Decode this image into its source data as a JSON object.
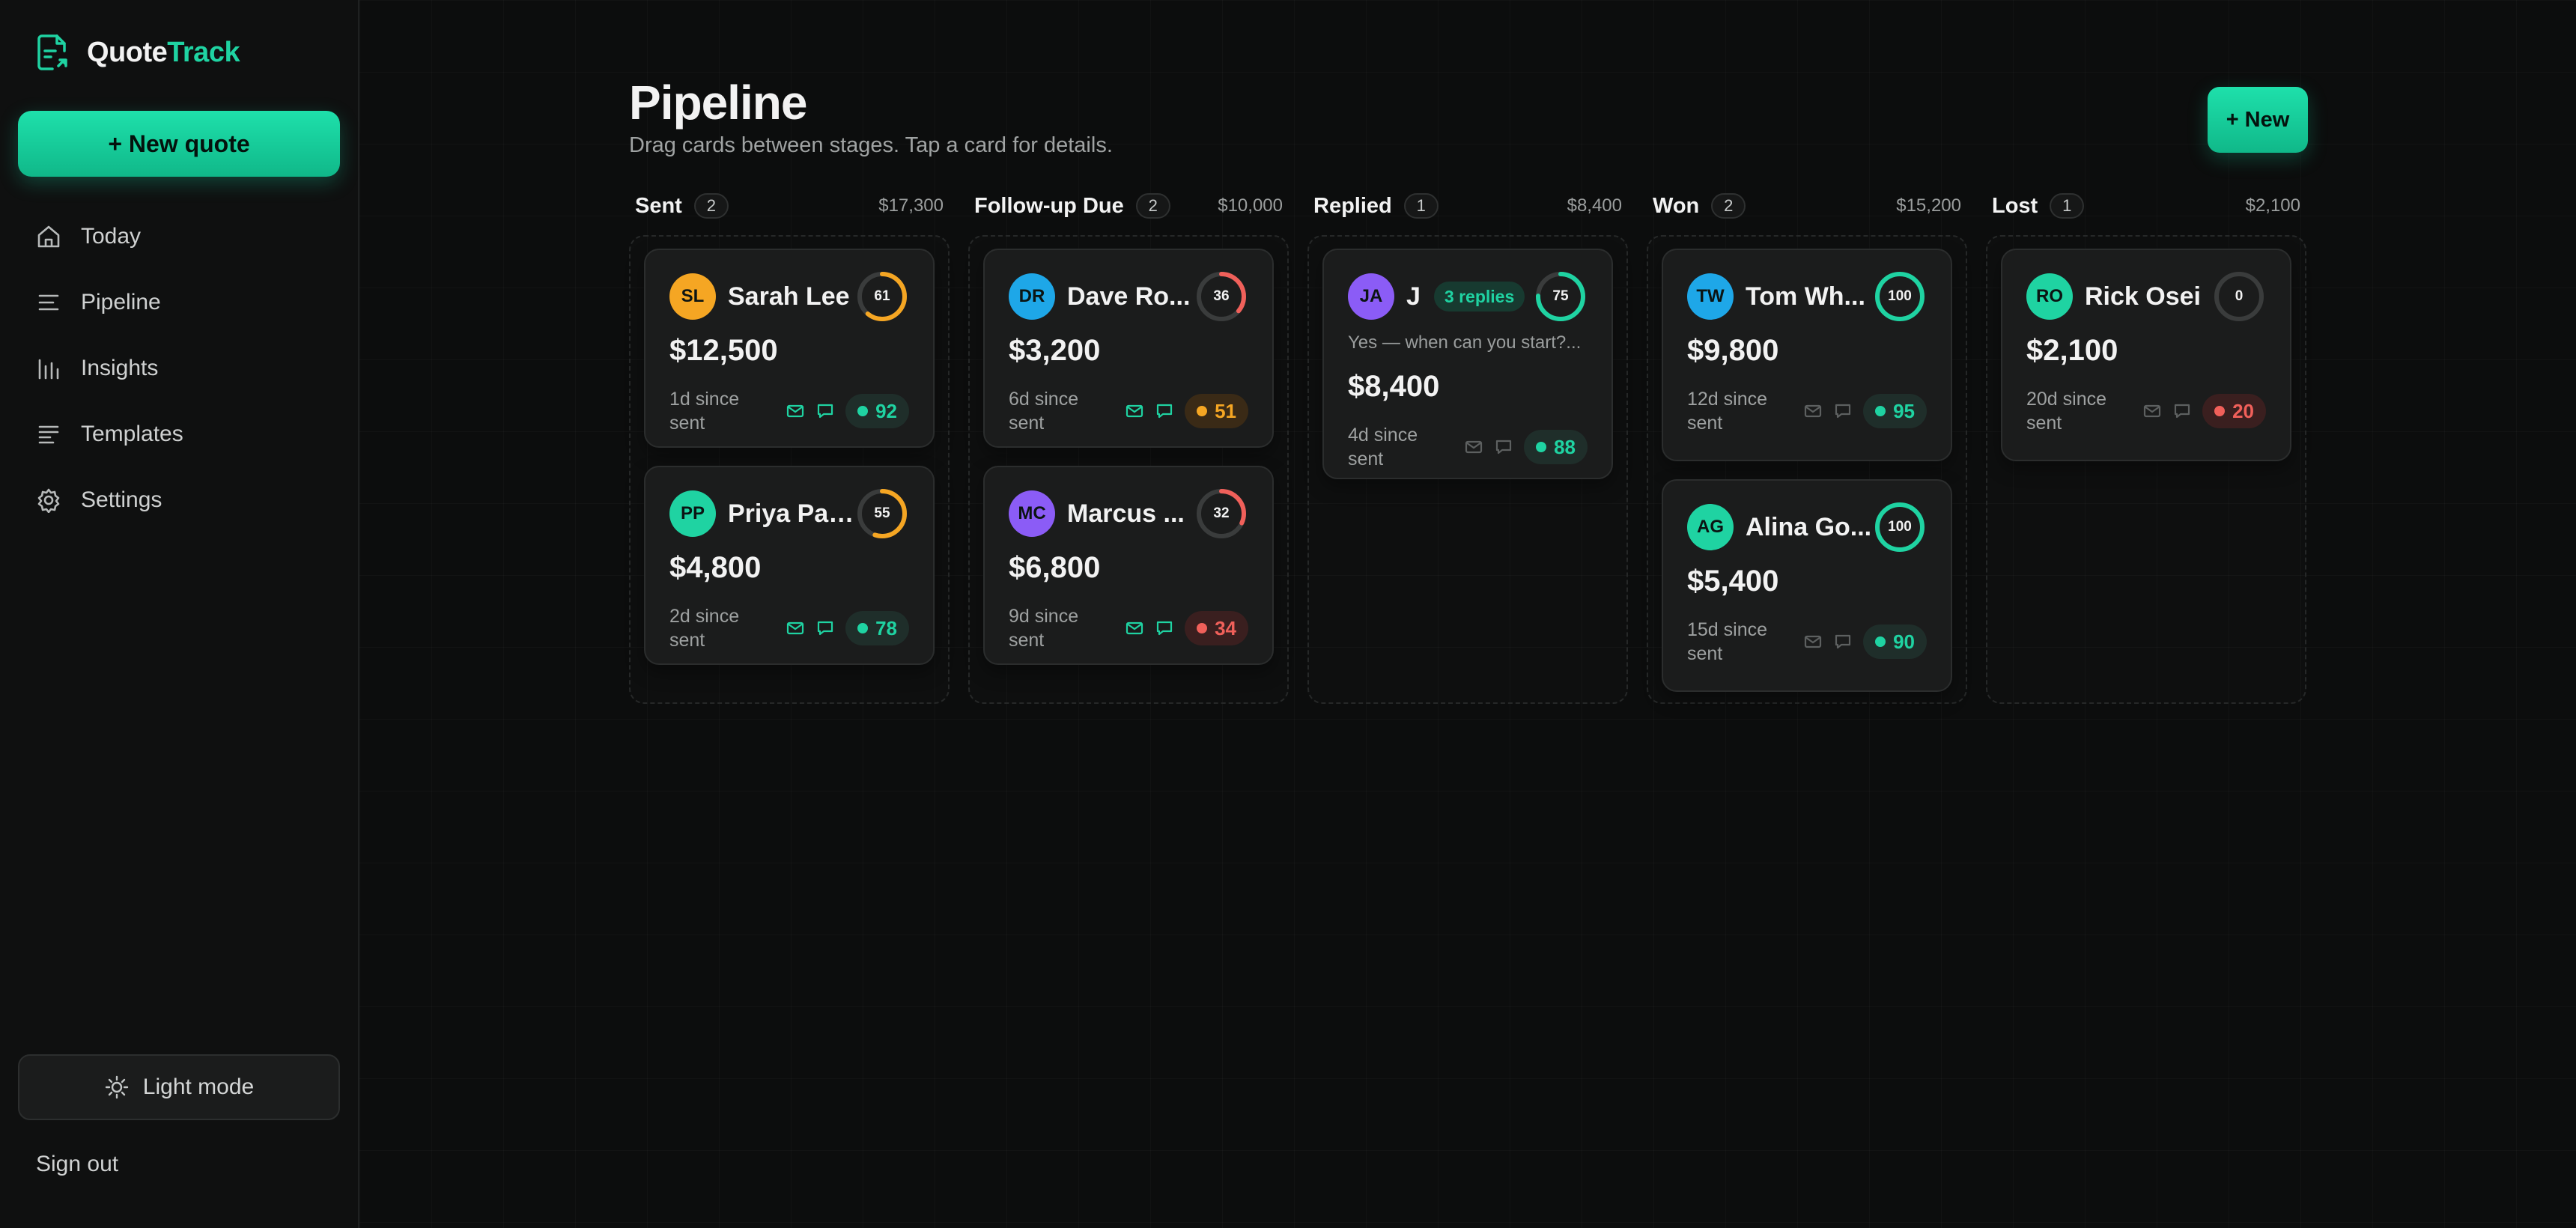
{
  "app": {
    "logo_part1": "Quote",
    "logo_part2": "Track",
    "new_quote": "+ New quote",
    "accent_color": "#1fd3a2"
  },
  "sidebar": {
    "items": [
      {
        "label": "Today",
        "icon": "home-icon"
      },
      {
        "label": "Pipeline",
        "icon": "list-icon"
      },
      {
        "label": "Insights",
        "icon": "bar-chart-icon"
      },
      {
        "label": "Templates",
        "icon": "template-icon"
      },
      {
        "label": "Settings",
        "icon": "gear-icon"
      }
    ],
    "light_mode": "Light mode",
    "sign_out": "Sign out"
  },
  "main": {
    "title": "Pipeline",
    "subtitle": "Drag cards between stages. Tap a card for details.",
    "new_button": "+ New"
  },
  "columns": [
    {
      "title": "Sent",
      "count": "2",
      "total": "$17,300",
      "cards": [
        {
          "initials": "SL",
          "name": "Sarah Lee",
          "avatar_color": "#f5a623",
          "ring_value": "61",
          "ring_color": "#f5a623",
          "amount": "$12,500",
          "since": "1d since sent",
          "score": "92",
          "score_tone": "g",
          "icons_active": true
        },
        {
          "initials": "PP",
          "name": "Priya Patel",
          "avatar_color": "#1fd3a2",
          "ring_value": "55",
          "ring_color": "#f5a623",
          "amount": "$4,800",
          "since": "2d since sent",
          "score": "78",
          "score_tone": "g",
          "icons_active": true
        }
      ]
    },
    {
      "title": "Follow-up Due",
      "count": "2",
      "total": "$10,000",
      "cards": [
        {
          "initials": "DR",
          "name": "Dave Ro...",
          "avatar_color": "#1ea7e8",
          "ring_value": "36",
          "ring_color": "#f0605a",
          "amount": "$3,200",
          "since": "6d since sent",
          "score": "51",
          "score_tone": "o",
          "icons_active": true
        },
        {
          "initials": "MC",
          "name": "Marcus ...",
          "avatar_color": "#8b5cf6",
          "ring_value": "32",
          "ring_color": "#f0605a",
          "amount": "$6,800",
          "since": "9d since sent",
          "score": "34",
          "score_tone": "r",
          "icons_active": true
        }
      ]
    },
    {
      "title": "Replied",
      "count": "1",
      "total": "$8,400",
      "cards": [
        {
          "initials": "JA",
          "name": "J",
          "avatar_color": "#8b5cf6",
          "replies": "3 replies",
          "snippet": "Yes — when can you start?...",
          "ring_value": "75",
          "ring_color": "#1fd3a2",
          "amount": "$8,400",
          "since": "4d since sent",
          "score": "88",
          "score_tone": "g",
          "icons_active": false
        }
      ]
    },
    {
      "title": "Won",
      "count": "2",
      "total": "$15,200",
      "cards": [
        {
          "initials": "TW",
          "name": "Tom Wh...",
          "avatar_color": "#1ea7e8",
          "ring_value": "100",
          "ring_color": "#1fd3a2",
          "amount": "$9,800",
          "since": "12d since sent",
          "score": "95",
          "score_tone": "g",
          "icons_active": false
        },
        {
          "initials": "AG",
          "name": "Alina Go...",
          "avatar_color": "#1fd3a2",
          "ring_value": "100",
          "ring_color": "#1fd3a2",
          "amount": "$5,400",
          "since": "15d since sent",
          "score": "90",
          "score_tone": "g",
          "icons_active": false
        }
      ]
    },
    {
      "title": "Lost",
      "count": "1",
      "total": "$2,100",
      "cards": [
        {
          "initials": "RO",
          "name": "Rick Osei",
          "avatar_color": "#1fd3a2",
          "ring_value": "0",
          "ring_color": "#f0605a",
          "amount": "$2,100",
          "since": "20d since sent",
          "score": "20",
          "score_tone": "r",
          "icons_active": false
        }
      ]
    }
  ]
}
